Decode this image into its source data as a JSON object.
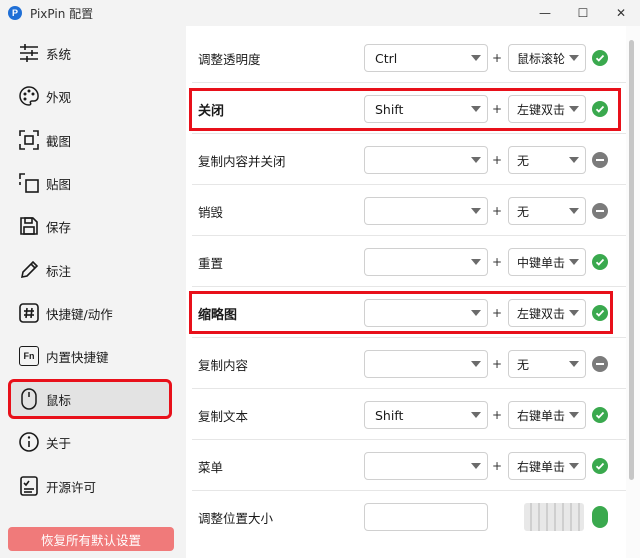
{
  "window": {
    "app_icon_letter": "P",
    "title": "PixPin 配置",
    "controls": {
      "minimize": "—",
      "maximize": "☐",
      "close": "✕"
    }
  },
  "sidebar": {
    "items": [
      {
        "label": "系统",
        "icon": "sliders-icon"
      },
      {
        "label": "外观",
        "icon": "palette-icon"
      },
      {
        "label": "截图",
        "icon": "screenshot-icon"
      },
      {
        "label": "贴图",
        "icon": "pin-image-icon"
      },
      {
        "label": "保存",
        "icon": "save-icon"
      },
      {
        "label": "标注",
        "icon": "pencil-icon"
      },
      {
        "label": "快捷键/动作",
        "icon": "hash-icon"
      },
      {
        "label": "内置快捷键",
        "icon": "fn-icon"
      },
      {
        "label": "鼠标",
        "icon": "mouse-icon",
        "active": true
      },
      {
        "label": "关于",
        "icon": "info-icon"
      },
      {
        "label": "开源许可",
        "icon": "license-icon"
      }
    ],
    "reset_label": "恢复所有默认设置",
    "fn_text": "Fn"
  },
  "rows": [
    {
      "label": "调整透明度",
      "modifier": "Ctrl",
      "button": "鼠标滚轮",
      "status": "enabled"
    },
    {
      "label": "关闭",
      "modifier": "Shift",
      "button": "左键双击",
      "status": "enabled"
    },
    {
      "label": "复制内容并关闭",
      "modifier": "",
      "button": "无",
      "status": "disabled"
    },
    {
      "label": "销毁",
      "modifier": "",
      "button": "无",
      "status": "disabled"
    },
    {
      "label": "重置",
      "modifier": "",
      "button": "中键单击",
      "status": "enabled"
    },
    {
      "label": "缩略图",
      "modifier": "",
      "button": "左键双击",
      "status": "enabled"
    },
    {
      "label": "复制内容",
      "modifier": "",
      "button": "无",
      "status": "disabled"
    },
    {
      "label": "复制文本",
      "modifier": "Shift",
      "button": "右键单击",
      "status": "enabled"
    },
    {
      "label": "菜单",
      "modifier": "",
      "button": "右键单击",
      "status": "enabled"
    },
    {
      "label": "调整位置大小",
      "modifier": "",
      "button": "",
      "status": "enabled"
    }
  ],
  "plus_sign": "+",
  "colors": {
    "accent_red": "#e8101a",
    "ok_green": "#3aa94e",
    "disabled_gray": "#7b7b7b",
    "reset_button": "#f07a7a"
  }
}
